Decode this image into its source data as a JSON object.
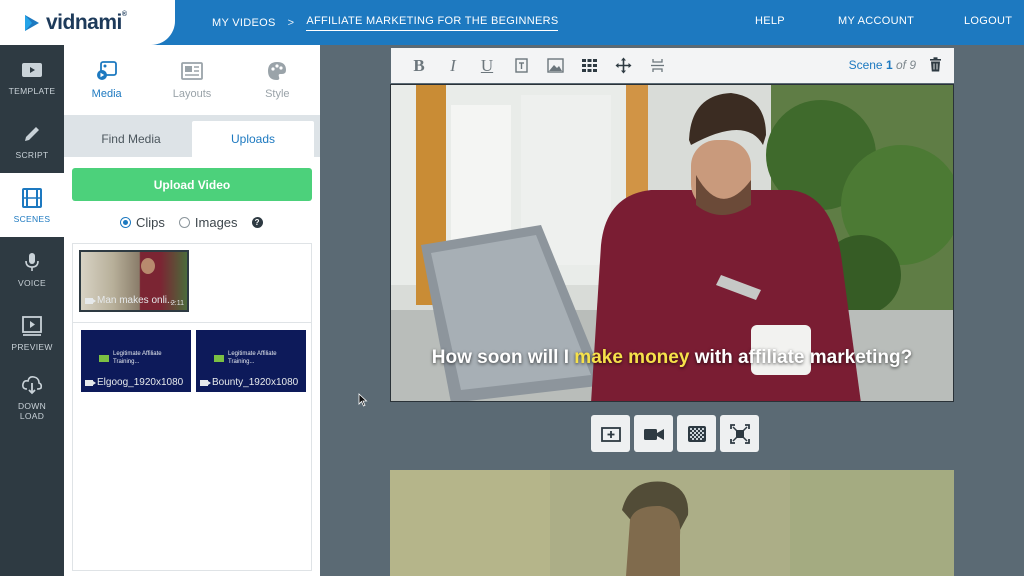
{
  "brand": {
    "name": "vidnami",
    "mark": "®"
  },
  "breadcrumb": {
    "home": "MY VIDEOS",
    "separator": ">",
    "current": "AFFILIATE MARKETING FOR THE BEGINNERS"
  },
  "topnav": {
    "help": "HELP",
    "account": "MY ACCOUNT",
    "logout": "LOGOUT"
  },
  "rail": [
    {
      "label": "TEMPLATE",
      "icon": "template-icon"
    },
    {
      "label": "SCRIPT",
      "icon": "pencil-icon"
    },
    {
      "label": "SCENES",
      "icon": "film-icon",
      "active": true
    },
    {
      "label": "VOICE",
      "icon": "microphone-icon"
    },
    {
      "label": "PREVIEW",
      "icon": "preview-icon"
    },
    {
      "label_line1": "DOWN",
      "label_line2": "LOAD",
      "icon": "download-icon"
    }
  ],
  "panel_tabs": [
    {
      "label": "Media",
      "icon": "media-icon",
      "active": true
    },
    {
      "label": "Layouts",
      "icon": "layouts-icon"
    },
    {
      "label": "Style",
      "icon": "palette-icon"
    }
  ],
  "subtabs": {
    "find": "Find Media",
    "uploads": "Uploads"
  },
  "upload_button": "Upload Video",
  "filter": {
    "clips": "Clips",
    "images": "Images",
    "selected": "Clips",
    "help": "?"
  },
  "clips": [
    {
      "label": "Man makes onli...",
      "duration": "2:11",
      "selected": true
    },
    {
      "label": "Elgoog_1920x1080",
      "caption": "Legitimate Affiliate Training..."
    },
    {
      "label": "Bounty_1920x1080",
      "caption": "Legitimate Affiliate Training..."
    }
  ],
  "toolbar": {
    "bold": "B",
    "italic": "I",
    "underline": "U",
    "scene_word": "Scene",
    "scene_current": "1",
    "scene_of": "of 9"
  },
  "scene": {
    "subtitle_before": "How soon will I ",
    "subtitle_highlight": "make money",
    "subtitle_after": " with affiliate marketing?"
  },
  "colors": {
    "accent": "#1d79c0",
    "upload": "#4cd17b",
    "rail": "#2e3a42",
    "highlight": "#f6e14a"
  }
}
